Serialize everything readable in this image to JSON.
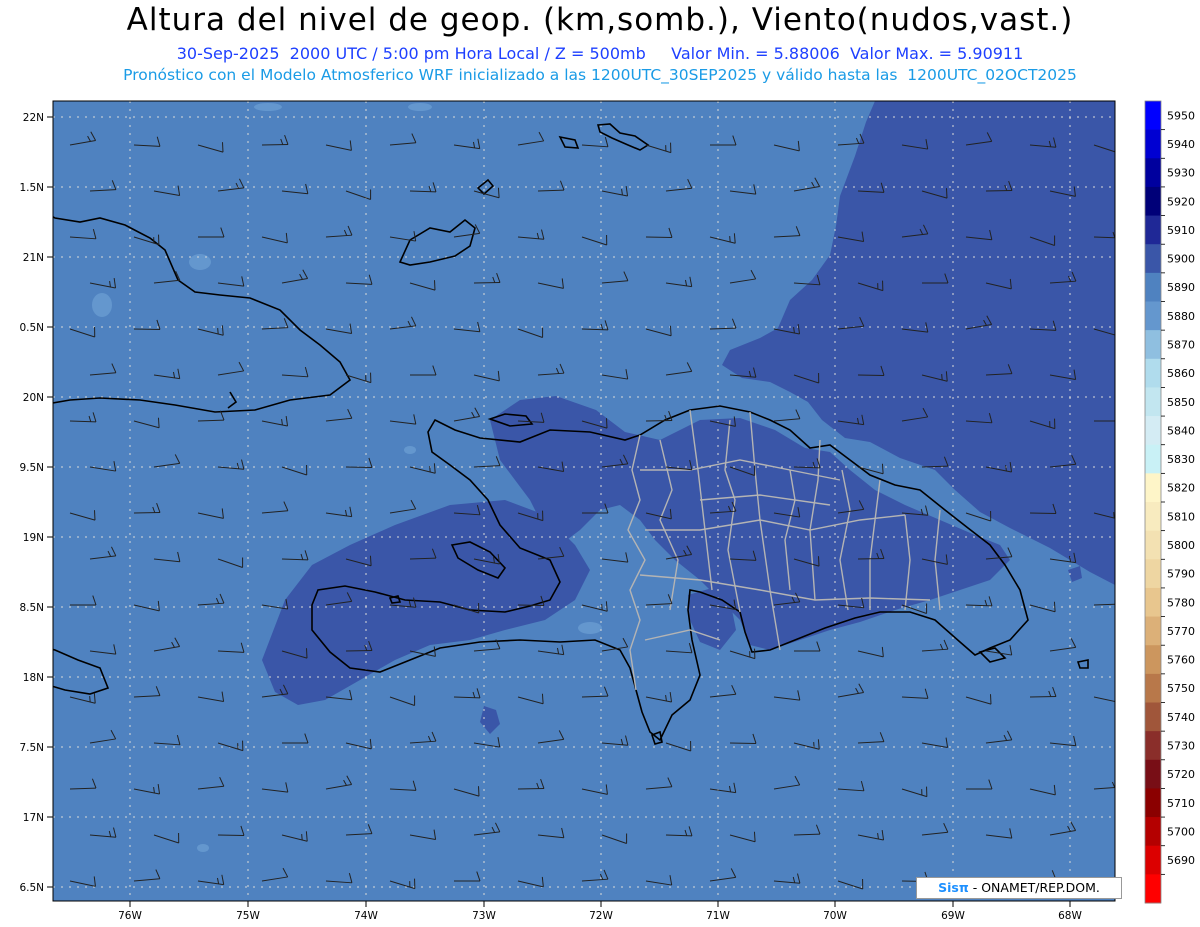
{
  "header": {
    "title": "Altura del nivel de geop. (km,somb.), Viento(nudos,vast.)",
    "line1": "30-Sep-2025  2000 UTC / 5:00 pm Hora Local / Z = 500mb     Valor Min. = 5.88006  Valor Max. = 5.90911",
    "line2": "Pronóstico con el Modelo Atmosferico WRF inicializado a las 1200UTC_30SEP2025 y válido hasta las  1200UTC_02OCT2025"
  },
  "map": {
    "lat_labels": [
      "22N",
      "1.5N",
      "21N",
      "0.5N",
      "20N",
      "9.5N",
      "19N",
      "8.5N",
      "18N",
      "7.5N",
      "17N",
      "6.5N"
    ],
    "lon_labels": [
      "76W",
      "75W",
      "74W",
      "73W",
      "72W",
      "71W",
      "70W",
      "69W",
      "68W"
    ],
    "colors": {
      "ocean_5890": "#4f82c0",
      "high_5900": "#3a56a8",
      "low_5880": "#6497ce",
      "coast": "#000000",
      "borders": "#b4b4b4",
      "grid": "#d9d9d9"
    }
  },
  "colorbar": {
    "levels": [
      "5950",
      "5940",
      "5930",
      "5920",
      "5910",
      "5900",
      "5890",
      "5880",
      "5870",
      "5860",
      "5850",
      "5840",
      "5830",
      "5820",
      "5810",
      "5800",
      "5790",
      "5780",
      "5770",
      "5760",
      "5750",
      "5740",
      "5730",
      "5720",
      "5710",
      "5700",
      "5690"
    ],
    "colors": [
      "#0000ff",
      "#0000d2",
      "#00009e",
      "#000078",
      "#1f2896",
      "#3a56a8",
      "#4f82c0",
      "#6497ce",
      "#8fbfe0",
      "#b0dced",
      "#c2e6f0",
      "#d4ecf4",
      "#c9f1f6",
      "#fef5c8",
      "#f8ebbf",
      "#f3e1b2",
      "#eed6a2",
      "#e8c68e",
      "#dcb078",
      "#cc965e",
      "#b8784a",
      "#a0563a",
      "#8a2e2a",
      "#780e16",
      "#8b0000",
      "#b40000",
      "#dc0000",
      "#ff0000"
    ]
  },
  "credit": {
    "logo": "Sisπ",
    "text": " - ONAMET/REP.DOM."
  }
}
